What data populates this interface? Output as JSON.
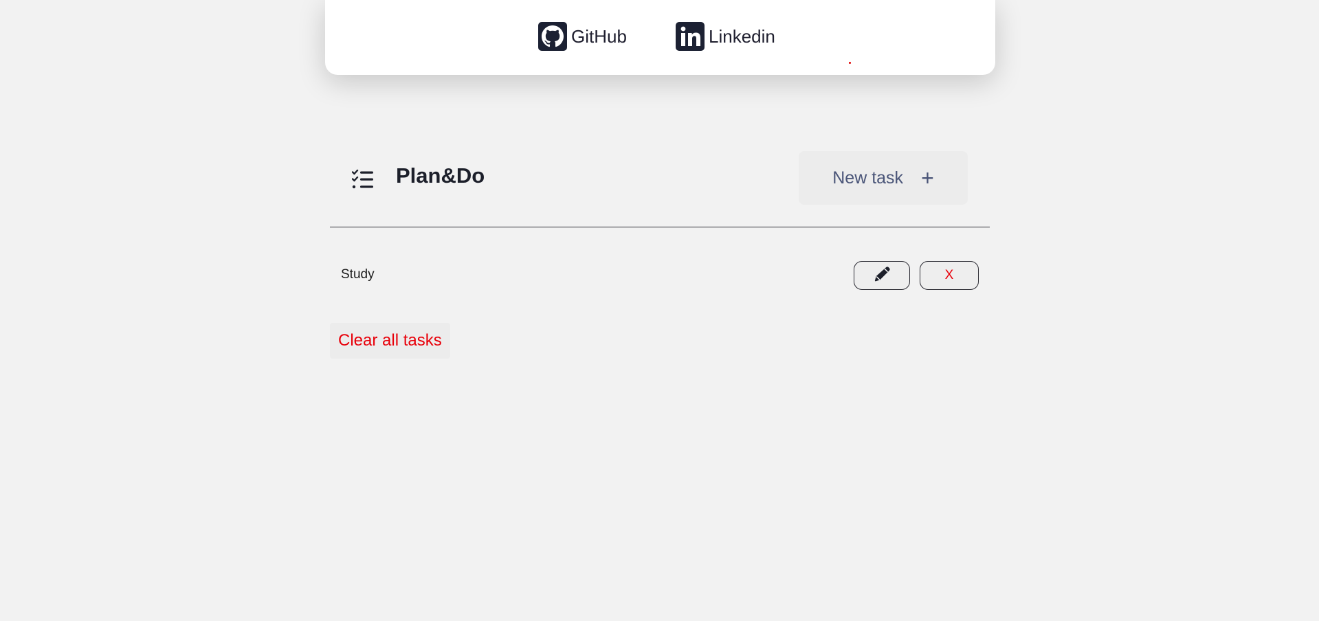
{
  "social": {
    "github_label": "GitHub",
    "linkedin_label": "Linkedin",
    "github_icon": "github-icon",
    "linkedin_icon": "linkedin-icon"
  },
  "header": {
    "icon": "checklist-icon",
    "title": "Plan&Do",
    "new_task_label": "New task",
    "new_task_icon": "+"
  },
  "tasks": [
    {
      "text": "Study",
      "edit_icon": "pencil-icon",
      "delete_label": "X"
    }
  ],
  "footer": {
    "clear_label": "Clear all tasks"
  },
  "colors": {
    "background": "#f2f2f2",
    "card": "#ffffff",
    "accent_red": "#e8000a",
    "button_text": "#4a5578",
    "icon_dark": "#1c2133"
  }
}
